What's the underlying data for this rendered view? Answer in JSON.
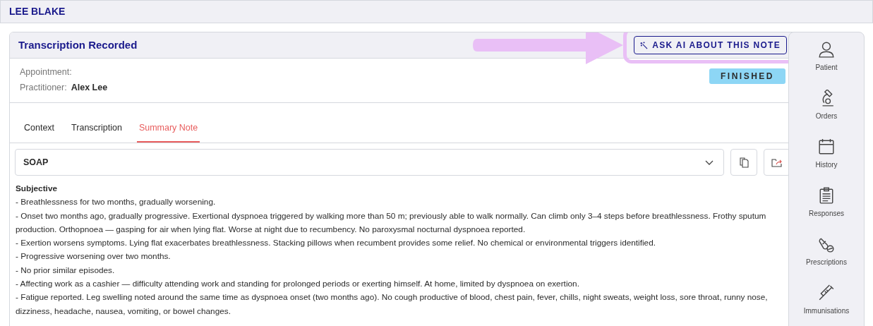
{
  "patient_name": "LEE BLAKE",
  "card": {
    "title": "Transcription Recorded",
    "ask_ai_button": {
      "label": "ASK AI ABOUT THIS NOTE",
      "highlighted": true
    },
    "fields": [
      {
        "label": "Appointment:"
      },
      {
        "label": "Practitioner:",
        "value": "Alex Lee"
      }
    ],
    "status_badge": "FINISHED",
    "tabs": [
      {
        "label": "Context",
        "selected": false
      },
      {
        "label": "Transcription",
        "selected": false
      },
      {
        "label": "Summary Note",
        "selected": true
      }
    ],
    "template_select": {
      "value": "SOAP"
    },
    "note": {
      "heading": "Subjective",
      "lines": [
        "- Breathlessness for two months, gradually worsening.",
        "- Onset two months ago, gradually progressive. Exertional dyspnoea triggered by walking more than 50 m; previously able to walk normally. Can climb only 3–4 steps before breathlessness. Frothy sputum production. Orthopnoea — gasping for air when lying flat. Worse at night due to recumbency. No paroxysmal nocturnal dyspnoea reported.",
        "- Exertion worsens symptoms. Lying flat exacerbates breathlessness. Stacking pillows when recumbent provides some relief. No chemical or environmental triggers identified.",
        "- Progressive worsening over two months.",
        "- No prior similar episodes.",
        "- Affecting work as a cashier — difficulty attending work and standing for prolonged periods or exerting himself. At home, limited by dyspnoea on exertion.",
        "- Fatigue reported. Leg swelling noted around the same time as dyspnoea onset (two months ago). No cough productive of blood, chest pain, fever, chills, night sweats, weight loss, sore throat, runny nose, dizziness, headache, nausea, vomiting, or bowel changes."
      ]
    }
  },
  "sidebar": {
    "items": [
      {
        "kind": "patient",
        "label": "Patient"
      },
      {
        "kind": "orders",
        "label": "Orders"
      },
      {
        "kind": "history",
        "label": "History"
      },
      {
        "kind": "responses",
        "label": "Responses"
      },
      {
        "kind": "prescriptions",
        "label": "Prescriptions"
      },
      {
        "kind": "immunisations",
        "label": "Immunisations"
      }
    ]
  }
}
